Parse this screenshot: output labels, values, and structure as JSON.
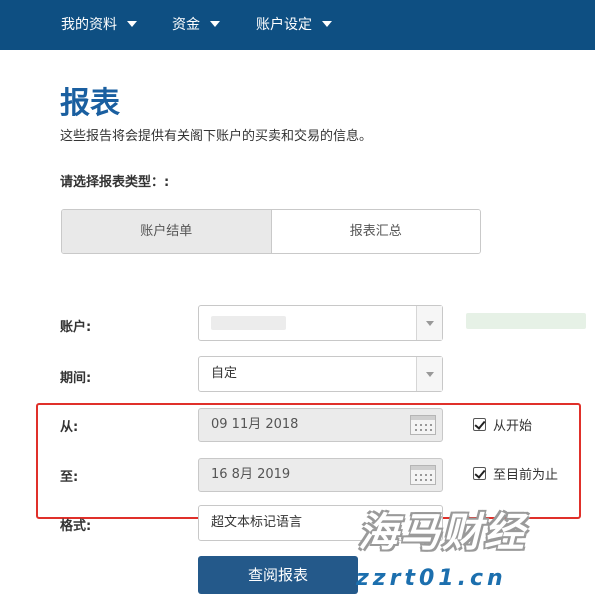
{
  "nav": {
    "items": [
      {
        "label": "我的资料"
      },
      {
        "label": "资金"
      },
      {
        "label": "账户设定"
      }
    ],
    "background_color": "#0e4f82"
  },
  "page": {
    "title": "报表",
    "description": "这些报告将会提供有关阁下账户的买卖和交易的信息。",
    "select_type_label": "请选择报表类型：:"
  },
  "report_tabs": [
    {
      "label": "账户结单",
      "active": true
    },
    {
      "label": "报表汇总",
      "active": false
    }
  ],
  "form": {
    "account": {
      "label": "账户:",
      "value": ""
    },
    "period": {
      "label": "期间:",
      "value": "自定"
    },
    "from": {
      "label": "从:",
      "value": "09 11月 2018",
      "checkbox_label": "从开始",
      "checked": true
    },
    "to": {
      "label": "至:",
      "value": "16 8月 2019",
      "checkbox_label": "至目前为止",
      "checked": true
    },
    "format": {
      "label": "格式:",
      "value": "超文本标记语言"
    }
  },
  "actions": {
    "submit_label": "查阅报表",
    "submit_color": "#24598a"
  },
  "watermark": {
    "title": "海马财经",
    "url": "zzrt01.cn"
  },
  "colors": {
    "title_blue": "#1a5fa0",
    "highlight_red": "#e0302a"
  }
}
